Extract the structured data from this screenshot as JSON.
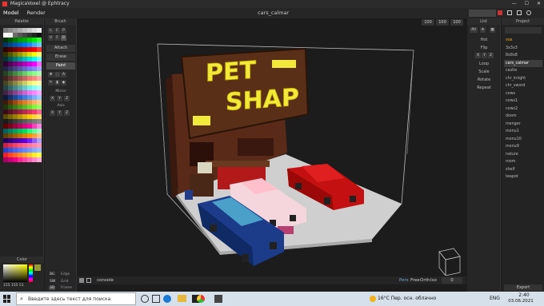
{
  "window": {
    "title": "MagicaVoxel @ Ephtracy",
    "controls": [
      "—",
      "☐",
      "✕"
    ]
  },
  "menu": {
    "tabs": [
      "Model",
      "Render"
    ],
    "active": "Model",
    "file": "cars_calmar"
  },
  "palette": {
    "title": "Palette",
    "swatches": [
      "#7a7a7a",
      "#8a8a8a",
      "#9a9a9a",
      "#aaaaaa",
      "#bcbcbc",
      "#cccccc",
      "#dddddd",
      "#eeeeee",
      "#ffffff",
      "#f5f5f5",
      "#6a6a6a",
      "#555",
      "#444",
      "#333",
      "#222",
      "#111",
      "#003300",
      "#005500",
      "#007700",
      "#009900",
      "#00aa00",
      "#00cc00",
      "#00ee00",
      "#33ff33",
      "#003366",
      "#004488",
      "#0055aa",
      "#0066cc",
      "#0077ee",
      "#2288ff",
      "#44aaff",
      "#66ccff",
      "#330000",
      "#550000",
      "#770000",
      "#990000",
      "#bb0000",
      "#dd0000",
      "#ff0000",
      "#ff3333",
      "#333300",
      "#555500",
      "#777700",
      "#999900",
      "#bbbb00",
      "#dddd00",
      "#ffff00",
      "#ffff66",
      "#003333",
      "#005555",
      "#007777",
      "#009999",
      "#00bbbb",
      "#00dddd",
      "#00ffff",
      "#66ffff",
      "#330033",
      "#550055",
      "#770077",
      "#990099",
      "#bb00bb",
      "#dd00dd",
      "#ff00ff",
      "#ff66ff",
      "#222244",
      "#333366",
      "#444488",
      "#5555aa",
      "#6666cc",
      "#7777ee",
      "#8888ff",
      "#aaaaff",
      "#224422",
      "#336633",
      "#448844",
      "#55aa55",
      "#66cc66",
      "#77ee77",
      "#88ff88",
      "#aaffaa",
      "#442222",
      "#663333",
      "#884444",
      "#aa5555",
      "#cc6666",
      "#ee7777",
      "#ff8888",
      "#ffaaaa",
      "#444422",
      "#666633",
      "#888844",
      "#aaaa55",
      "#cccc66",
      "#eeee77",
      "#ffff88",
      "#ffffaa",
      "#224444",
      "#336666",
      "#448888",
      "#55aaaa",
      "#66cccc",
      "#77eeee",
      "#88ffff",
      "#aaffff",
      "#442244",
      "#663366",
      "#884488",
      "#aa55aa",
      "#cc66cc",
      "#ee77ee",
      "#ff88ff",
      "#ffaaff",
      "#0a1a3a",
      "#12306a",
      "#1b4a9a",
      "#2464ca",
      "#3a7ee0",
      "#5a98ee",
      "#7ab2ff",
      "#9accff",
      "#3a1a0a",
      "#6a300a",
      "#9a4a10",
      "#ca6418",
      "#e07e2a",
      "#ee9848",
      "#ffb266",
      "#ffcc88",
      "#1a3a0a",
      "#2a5a10",
      "#3a7a18",
      "#4a9a20",
      "#5aba28",
      "#6ada30",
      "#7afa38",
      "#9aff66",
      "#3a0a1a",
      "#5a1028",
      "#7a1838",
      "#9a2048",
      "#ba2858",
      "#da3068",
      "#fa3878",
      "#ff66a0",
      "#5a4a00",
      "#7a6400",
      "#9a7e00",
      "#ba9800",
      "#dab200",
      "#facc00",
      "#ffd633",
      "#ffe066",
      "#1a1a1a",
      "#2a2a2a",
      "#3a3a3a",
      "#4a4a4a",
      "#5a5a5a",
      "#6a6a6a",
      "#7a7a7a",
      "#8a8a8a",
      "#600000",
      "#800020",
      "#a00040",
      "#c00060",
      "#e00080",
      "#ff00a0",
      "#ff40c0",
      "#ff80e0",
      "#006060",
      "#008060",
      "#00a060",
      "#00c060",
      "#00e060",
      "#20ff80",
      "#60ffa0",
      "#a0ffc0",
      "#604000",
      "#805000",
      "#a06000",
      "#c07000",
      "#e08000",
      "#ff9000",
      "#ffa040",
      "#ffc080",
      "#200060",
      "#300080",
      "#4000a0",
      "#5000c0",
      "#6000e0",
      "#7020ff",
      "#9060ff",
      "#b0a0ff",
      "#cc2244",
      "#dd3355",
      "#ee4466",
      "#ff5577",
      "#ff6688",
      "#ff7799",
      "#ff88aa",
      "#ff99bb",
      "#2244cc",
      "#3355dd",
      "#4466ee",
      "#5577ff",
      "#6688ff",
      "#7799ff",
      "#88aaff",
      "#99bbff",
      "#ee2222",
      "#ff4422",
      "#ff6622",
      "#ff8822",
      "#ffaa22",
      "#ffcc22",
      "#ffee22",
      "#ffff44",
      "#aa0066",
      "#cc0077",
      "#ee0088",
      "#ff2299",
      "#ff44aa",
      "#ff66bb",
      "#ff88cc",
      "#ffaadd"
    ],
    "color": {
      "label": "Color",
      "rgb": "155  155  51",
      "hex": "51"
    }
  },
  "brush": {
    "title": "Brush",
    "modes": [
      "L",
      "C",
      "P",
      "V",
      "F",
      "B"
    ],
    "actions": [
      "Attach",
      "Erase",
      "Paint"
    ],
    "mirror": {
      "label": "Mirror",
      "axes": [
        "X",
        "Y",
        "Z"
      ]
    },
    "axis": {
      "label": "Axis",
      "axes": [
        "X",
        "Y",
        "Z"
      ]
    },
    "bottom": [
      {
        "key": "BG",
        "label": "Edge"
      },
      {
        "key": "SW",
        "label": "Grid"
      },
      {
        "key": "3D",
        "label": "Frame"
      }
    ]
  },
  "viewport": {
    "size": [
      "100",
      "100",
      "100"
    ],
    "console": "console",
    "camera_modes": [
      "Pers",
      "Free",
      "Orth",
      "Iso"
    ],
    "camera_value": "0",
    "sign": {
      "line1": "PET",
      "line2": "SHAP"
    }
  },
  "list": {
    "title": "List",
    "items": [
      "Hot",
      "Flip",
      "Loop",
      "Scale",
      "Rotate",
      "Repeat"
    ],
    "axes": [
      "X",
      "Y",
      "Z"
    ]
  },
  "project": {
    "title": "Project",
    "items": [
      "vox",
      "3x3x3",
      "8x8x8",
      "cars_calmar",
      "castle",
      "chr_knight",
      "chr_sword",
      "cows",
      "cows1",
      "cows2",
      "doom",
      "menger",
      "monu1",
      "monu10",
      "monu9",
      "nature",
      "room",
      "shelf",
      "teapot"
    ],
    "selected": "cars_calmar",
    "export": "Export"
  },
  "taskbar": {
    "search_placeholder": "Введите здесь текст для поиска",
    "weather": "16°C  Пер. осн. облачно",
    "lang": "ENG",
    "time": "2:40",
    "date": "03.06.2021"
  }
}
